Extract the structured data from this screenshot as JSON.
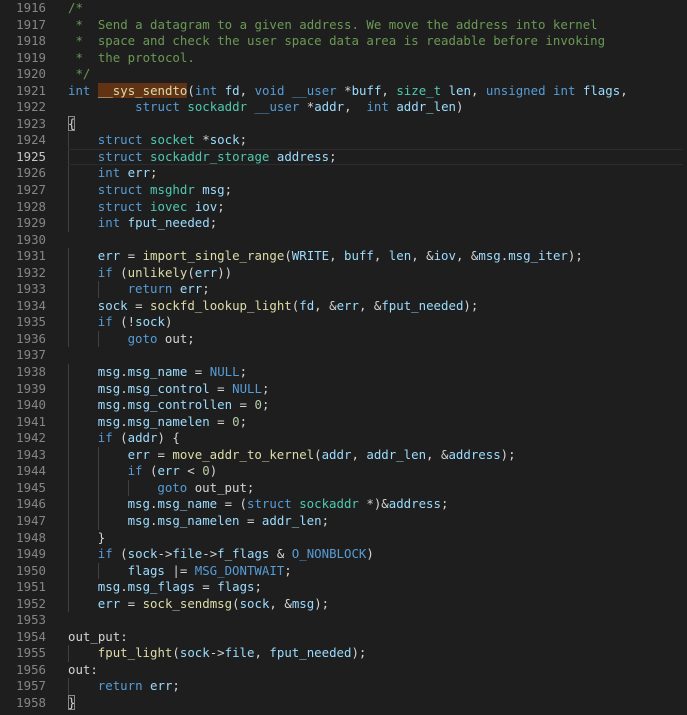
{
  "editor": {
    "active_line": "1925",
    "lines": [
      {
        "num": "1916",
        "indent": 0,
        "tokens": [
          [
            "cm",
            "/*"
          ]
        ]
      },
      {
        "num": "1917",
        "indent": 0,
        "tokens": [
          [
            "cm",
            " *  Send a datagram to a given address. We move the address into kernel"
          ]
        ]
      },
      {
        "num": "1918",
        "indent": 0,
        "tokens": [
          [
            "cm",
            " *  space and check the user space data area is readable before invoking"
          ]
        ]
      },
      {
        "num": "1919",
        "indent": 0,
        "tokens": [
          [
            "cm",
            " *  the protocol."
          ]
        ]
      },
      {
        "num": "1920",
        "indent": 0,
        "tokens": [
          [
            "cm",
            " */"
          ]
        ]
      },
      {
        "num": "1921",
        "indent": 0,
        "tokens": [
          [
            "kw",
            "int"
          ],
          [
            "pl",
            " "
          ],
          [
            "hl",
            "__sys_sendto"
          ],
          [
            "pl",
            "("
          ],
          [
            "kw",
            "int"
          ],
          [
            "pl",
            " "
          ],
          [
            "var",
            "fd"
          ],
          [
            "pl",
            ", "
          ],
          [
            "kw",
            "void"
          ],
          [
            "pl",
            " "
          ],
          [
            "kw",
            "__user"
          ],
          [
            "pl",
            " *"
          ],
          [
            "var",
            "buff"
          ],
          [
            "pl",
            ", "
          ],
          [
            "ty",
            "size_t"
          ],
          [
            "pl",
            " "
          ],
          [
            "var",
            "len"
          ],
          [
            "pl",
            ", "
          ],
          [
            "kw",
            "unsigned"
          ],
          [
            "pl",
            " "
          ],
          [
            "kw",
            "int"
          ],
          [
            "pl",
            " "
          ],
          [
            "var",
            "flags"
          ],
          [
            "pl",
            ","
          ]
        ]
      },
      {
        "num": "1922",
        "indent": 0,
        "tokens": [
          [
            "pl",
            "         "
          ],
          [
            "kw",
            "struct"
          ],
          [
            "pl",
            " "
          ],
          [
            "ty",
            "sockaddr"
          ],
          [
            "pl",
            " "
          ],
          [
            "kw",
            "__user"
          ],
          [
            "pl",
            " *"
          ],
          [
            "var",
            "addr"
          ],
          [
            "pl",
            ",  "
          ],
          [
            "kw",
            "int"
          ],
          [
            "pl",
            " "
          ],
          [
            "var",
            "addr_len"
          ],
          [
            "pl",
            ")"
          ]
        ]
      },
      {
        "num": "1923",
        "indent": 0,
        "tokens": [
          [
            "br",
            "{"
          ]
        ]
      },
      {
        "num": "1924",
        "indent": 1,
        "tokens": [
          [
            "kw",
            "struct"
          ],
          [
            "pl",
            " "
          ],
          [
            "ty",
            "socket"
          ],
          [
            "pl",
            " *"
          ],
          [
            "var",
            "sock"
          ],
          [
            "pl",
            ";"
          ]
        ]
      },
      {
        "num": "1925",
        "indent": 1,
        "tokens": [
          [
            "kw",
            "struct"
          ],
          [
            "pl",
            " "
          ],
          [
            "ty",
            "sockaddr_storage"
          ],
          [
            "pl",
            " "
          ],
          [
            "var",
            "address"
          ],
          [
            "pl",
            ";"
          ]
        ]
      },
      {
        "num": "1926",
        "indent": 1,
        "tokens": [
          [
            "kw",
            "int"
          ],
          [
            "pl",
            " "
          ],
          [
            "var",
            "err"
          ],
          [
            "pl",
            ";"
          ]
        ]
      },
      {
        "num": "1927",
        "indent": 1,
        "tokens": [
          [
            "kw",
            "struct"
          ],
          [
            "pl",
            " "
          ],
          [
            "ty",
            "msghdr"
          ],
          [
            "pl",
            " "
          ],
          [
            "var",
            "msg"
          ],
          [
            "pl",
            ";"
          ]
        ]
      },
      {
        "num": "1928",
        "indent": 1,
        "tokens": [
          [
            "kw",
            "struct"
          ],
          [
            "pl",
            " "
          ],
          [
            "ty",
            "iovec"
          ],
          [
            "pl",
            " "
          ],
          [
            "var",
            "iov"
          ],
          [
            "pl",
            ";"
          ]
        ]
      },
      {
        "num": "1929",
        "indent": 1,
        "tokens": [
          [
            "kw",
            "int"
          ],
          [
            "pl",
            " "
          ],
          [
            "var",
            "fput_needed"
          ],
          [
            "pl",
            ";"
          ]
        ]
      },
      {
        "num": "1930",
        "indent": 0,
        "tokens": []
      },
      {
        "num": "1931",
        "indent": 1,
        "tokens": [
          [
            "var",
            "err"
          ],
          [
            "pl",
            " = "
          ],
          [
            "fn",
            "import_single_range"
          ],
          [
            "pl",
            "("
          ],
          [
            "var",
            "WRITE"
          ],
          [
            "pl",
            ", "
          ],
          [
            "var",
            "buff"
          ],
          [
            "pl",
            ", "
          ],
          [
            "var",
            "len"
          ],
          [
            "pl",
            ", &"
          ],
          [
            "var",
            "iov"
          ],
          [
            "pl",
            ", &"
          ],
          [
            "var",
            "msg"
          ],
          [
            "pl",
            "."
          ],
          [
            "var",
            "msg_iter"
          ],
          [
            "pl",
            ");"
          ]
        ]
      },
      {
        "num": "1932",
        "indent": 1,
        "tokens": [
          [
            "kw",
            "if"
          ],
          [
            "pl",
            " ("
          ],
          [
            "fn",
            "unlikely"
          ],
          [
            "pl",
            "("
          ],
          [
            "var",
            "err"
          ],
          [
            "pl",
            "))"
          ]
        ]
      },
      {
        "num": "1933",
        "indent": 2,
        "tokens": [
          [
            "kw",
            "return"
          ],
          [
            "pl",
            " "
          ],
          [
            "var",
            "err"
          ],
          [
            "pl",
            ";"
          ]
        ]
      },
      {
        "num": "1934",
        "indent": 1,
        "tokens": [
          [
            "var",
            "sock"
          ],
          [
            "pl",
            " = "
          ],
          [
            "fn",
            "sockfd_lookup_light"
          ],
          [
            "pl",
            "("
          ],
          [
            "var",
            "fd"
          ],
          [
            "pl",
            ", &"
          ],
          [
            "var",
            "err"
          ],
          [
            "pl",
            ", &"
          ],
          [
            "var",
            "fput_needed"
          ],
          [
            "pl",
            ");"
          ]
        ]
      },
      {
        "num": "1935",
        "indent": 1,
        "tokens": [
          [
            "kw",
            "if"
          ],
          [
            "pl",
            " (!"
          ],
          [
            "var",
            "sock"
          ],
          [
            "pl",
            ")"
          ]
        ]
      },
      {
        "num": "1936",
        "indent": 2,
        "tokens": [
          [
            "kw",
            "goto"
          ],
          [
            "pl",
            " out;"
          ]
        ]
      },
      {
        "num": "1937",
        "indent": 0,
        "tokens": []
      },
      {
        "num": "1938",
        "indent": 1,
        "tokens": [
          [
            "var",
            "msg"
          ],
          [
            "pl",
            "."
          ],
          [
            "var",
            "msg_name"
          ],
          [
            "pl",
            " = "
          ],
          [
            "mac",
            "NULL"
          ],
          [
            "pl",
            ";"
          ]
        ]
      },
      {
        "num": "1939",
        "indent": 1,
        "tokens": [
          [
            "var",
            "msg"
          ],
          [
            "pl",
            "."
          ],
          [
            "var",
            "msg_control"
          ],
          [
            "pl",
            " = "
          ],
          [
            "mac",
            "NULL"
          ],
          [
            "pl",
            ";"
          ]
        ]
      },
      {
        "num": "1940",
        "indent": 1,
        "tokens": [
          [
            "var",
            "msg"
          ],
          [
            "pl",
            "."
          ],
          [
            "var",
            "msg_controllen"
          ],
          [
            "pl",
            " = "
          ],
          [
            "num",
            "0"
          ],
          [
            "pl",
            ";"
          ]
        ]
      },
      {
        "num": "1941",
        "indent": 1,
        "tokens": [
          [
            "var",
            "msg"
          ],
          [
            "pl",
            "."
          ],
          [
            "var",
            "msg_namelen"
          ],
          [
            "pl",
            " = "
          ],
          [
            "num",
            "0"
          ],
          [
            "pl",
            ";"
          ]
        ]
      },
      {
        "num": "1942",
        "indent": 1,
        "tokens": [
          [
            "kw",
            "if"
          ],
          [
            "pl",
            " ("
          ],
          [
            "var",
            "addr"
          ],
          [
            "pl",
            ") {"
          ]
        ]
      },
      {
        "num": "1943",
        "indent": 2,
        "tokens": [
          [
            "var",
            "err"
          ],
          [
            "pl",
            " = "
          ],
          [
            "fn",
            "move_addr_to_kernel"
          ],
          [
            "pl",
            "("
          ],
          [
            "var",
            "addr"
          ],
          [
            "pl",
            ", "
          ],
          [
            "var",
            "addr_len"
          ],
          [
            "pl",
            ", &"
          ],
          [
            "var",
            "address"
          ],
          [
            "pl",
            ");"
          ]
        ]
      },
      {
        "num": "1944",
        "indent": 2,
        "tokens": [
          [
            "kw",
            "if"
          ],
          [
            "pl",
            " ("
          ],
          [
            "var",
            "err"
          ],
          [
            "pl",
            " < "
          ],
          [
            "num",
            "0"
          ],
          [
            "pl",
            ")"
          ]
        ]
      },
      {
        "num": "1945",
        "indent": 3,
        "tokens": [
          [
            "kw",
            "goto"
          ],
          [
            "pl",
            " out_put;"
          ]
        ]
      },
      {
        "num": "1946",
        "indent": 2,
        "tokens": [
          [
            "var",
            "msg"
          ],
          [
            "pl",
            "."
          ],
          [
            "var",
            "msg_name"
          ],
          [
            "pl",
            " = ("
          ],
          [
            "kw",
            "struct"
          ],
          [
            "pl",
            " "
          ],
          [
            "ty",
            "sockaddr"
          ],
          [
            "pl",
            " *)&"
          ],
          [
            "var",
            "address"
          ],
          [
            "pl",
            ";"
          ]
        ]
      },
      {
        "num": "1947",
        "indent": 2,
        "tokens": [
          [
            "var",
            "msg"
          ],
          [
            "pl",
            "."
          ],
          [
            "var",
            "msg_namelen"
          ],
          [
            "pl",
            " = "
          ],
          [
            "var",
            "addr_len"
          ],
          [
            "pl",
            ";"
          ]
        ]
      },
      {
        "num": "1948",
        "indent": 1,
        "tokens": [
          [
            "pl",
            "}"
          ]
        ]
      },
      {
        "num": "1949",
        "indent": 1,
        "tokens": [
          [
            "kw",
            "if"
          ],
          [
            "pl",
            " ("
          ],
          [
            "var",
            "sock"
          ],
          [
            "pl",
            "->"
          ],
          [
            "var",
            "file"
          ],
          [
            "pl",
            "->"
          ],
          [
            "var",
            "f_flags"
          ],
          [
            "pl",
            " & "
          ],
          [
            "mac",
            "O_NONBLOCK"
          ],
          [
            "pl",
            ")"
          ]
        ]
      },
      {
        "num": "1950",
        "indent": 2,
        "tokens": [
          [
            "var",
            "flags"
          ],
          [
            "pl",
            " |= "
          ],
          [
            "mac",
            "MSG_DONTWAIT"
          ],
          [
            "pl",
            ";"
          ]
        ]
      },
      {
        "num": "1951",
        "indent": 1,
        "tokens": [
          [
            "var",
            "msg"
          ],
          [
            "pl",
            "."
          ],
          [
            "var",
            "msg_flags"
          ],
          [
            "pl",
            " = "
          ],
          [
            "var",
            "flags"
          ],
          [
            "pl",
            ";"
          ]
        ]
      },
      {
        "num": "1952",
        "indent": 1,
        "tokens": [
          [
            "var",
            "err"
          ],
          [
            "pl",
            " = "
          ],
          [
            "fn",
            "sock_sendmsg"
          ],
          [
            "pl",
            "("
          ],
          [
            "var",
            "sock"
          ],
          [
            "pl",
            ", &"
          ],
          [
            "var",
            "msg"
          ],
          [
            "pl",
            ");"
          ]
        ]
      },
      {
        "num": "1953",
        "indent": 0,
        "tokens": []
      },
      {
        "num": "1954",
        "indent": 0,
        "tokens": [
          [
            "pl",
            "out_put:"
          ]
        ]
      },
      {
        "num": "1955",
        "indent": 1,
        "tokens": [
          [
            "fn",
            "fput_light"
          ],
          [
            "pl",
            "("
          ],
          [
            "var",
            "sock"
          ],
          [
            "pl",
            "->"
          ],
          [
            "var",
            "file"
          ],
          [
            "pl",
            ", "
          ],
          [
            "var",
            "fput_needed"
          ],
          [
            "pl",
            ");"
          ]
        ]
      },
      {
        "num": "1956",
        "indent": 0,
        "tokens": [
          [
            "pl",
            "out:"
          ]
        ]
      },
      {
        "num": "1957",
        "indent": 1,
        "tokens": [
          [
            "kw",
            "return"
          ],
          [
            "pl",
            " "
          ],
          [
            "var",
            "err"
          ],
          [
            "pl",
            ";"
          ]
        ]
      },
      {
        "num": "1958",
        "indent": 0,
        "tokens": [
          [
            "br",
            "}"
          ]
        ]
      }
    ]
  }
}
